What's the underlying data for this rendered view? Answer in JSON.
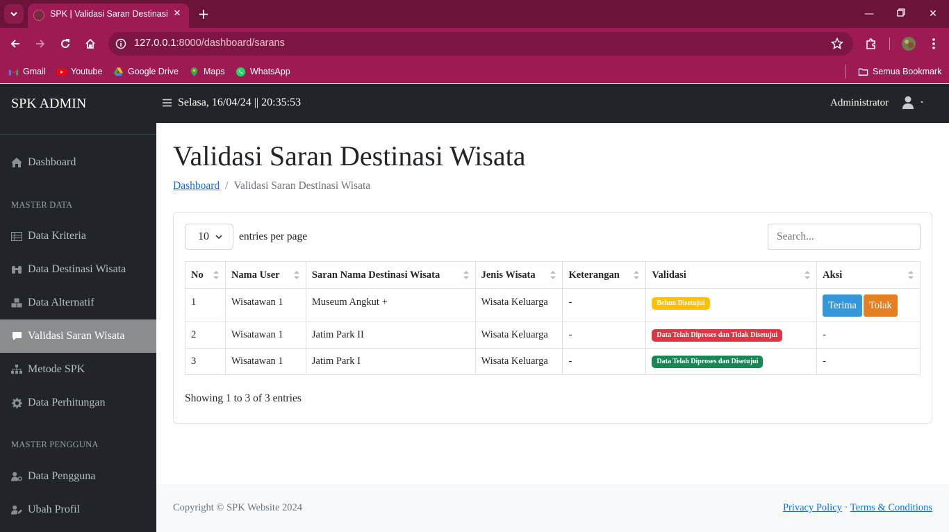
{
  "browser": {
    "tab_title": "SPK | Validasi Saran Destinasi W",
    "url_host": "127.0.0.1",
    "url_rest": ":8000/dashboard/sarans",
    "bookmarks": [
      "Gmail",
      "Youtube",
      "Google Drive",
      "Maps",
      "WhatsApp"
    ],
    "all_bookmarks": "Semua Bookmark"
  },
  "sidebar": {
    "brand": "SPK ADMIN",
    "dashboard": "Dashboard",
    "section_master_data": "MASTER DATA",
    "data_kriteria": "Data Kriteria",
    "data_destinasi": "Data Destinasi Wisata",
    "data_alternatif": "Data Alternatif",
    "validasi_saran": "Validasi Saran Wisata",
    "metode_spk": "Metode SPK",
    "data_perhitungan": "Data Perhitungan",
    "section_master_pengguna": "MASTER PENGGUNA",
    "data_pengguna": "Data Pengguna",
    "ubah_profil": "Ubah Profil"
  },
  "topnav": {
    "datetime": "Selasa, 16/04/24 || 20:35:53",
    "user": "Administrator"
  },
  "main": {
    "title": "Validasi Saran Destinasi Wisata",
    "breadcrumb_home": "Dashboard",
    "breadcrumb_current": "Validasi Saran Destinasi Wisata",
    "per_page_value": "10",
    "per_page_label": "entries per page",
    "search_placeholder": "Search...",
    "columns": [
      "No",
      "Nama User",
      "Saran Nama Destinasi Wisata",
      "Jenis Wisata",
      "Keterangan",
      "Validasi",
      "Aksi"
    ],
    "rows": [
      {
        "no": "1",
        "user": "Wisatawan 1",
        "saran": "Museum Angkut +",
        "jenis": "Wisata Keluarga",
        "keterangan": "-",
        "validasi": "Belum Disetujui",
        "aksi": ""
      },
      {
        "no": "2",
        "user": "Wisatawan 1",
        "saran": "Jatim Park II",
        "jenis": "Wisata Keluarga",
        "keterangan": "-",
        "validasi": "Data Telah Diproses dan Tidak Disetujui",
        "aksi": "-"
      },
      {
        "no": "3",
        "user": "Wisatawan 1",
        "saran": "Jatim Park I",
        "jenis": "Wisata Keluarga",
        "keterangan": "-",
        "validasi": "Data Telah Diproses dan Disetujui",
        "aksi": "-"
      }
    ],
    "btn_terima": "Terima",
    "btn_tolak": "Tolak",
    "showing": "Showing 1 to 3 of 3 entries"
  },
  "footer": {
    "copyright": "Copyright © SPK Website 2024",
    "privacy": "Privacy Policy",
    "dot": "·",
    "terms": "Terms & Conditions"
  },
  "colors": {
    "sidebar_bg": "#212529",
    "active_item": "#8a8d90",
    "badge_warning": "#ffc107",
    "badge_danger": "#dc3545",
    "badge_success": "#198754",
    "btn_terima": "#3498db",
    "btn_tolak": "#e67e22"
  }
}
